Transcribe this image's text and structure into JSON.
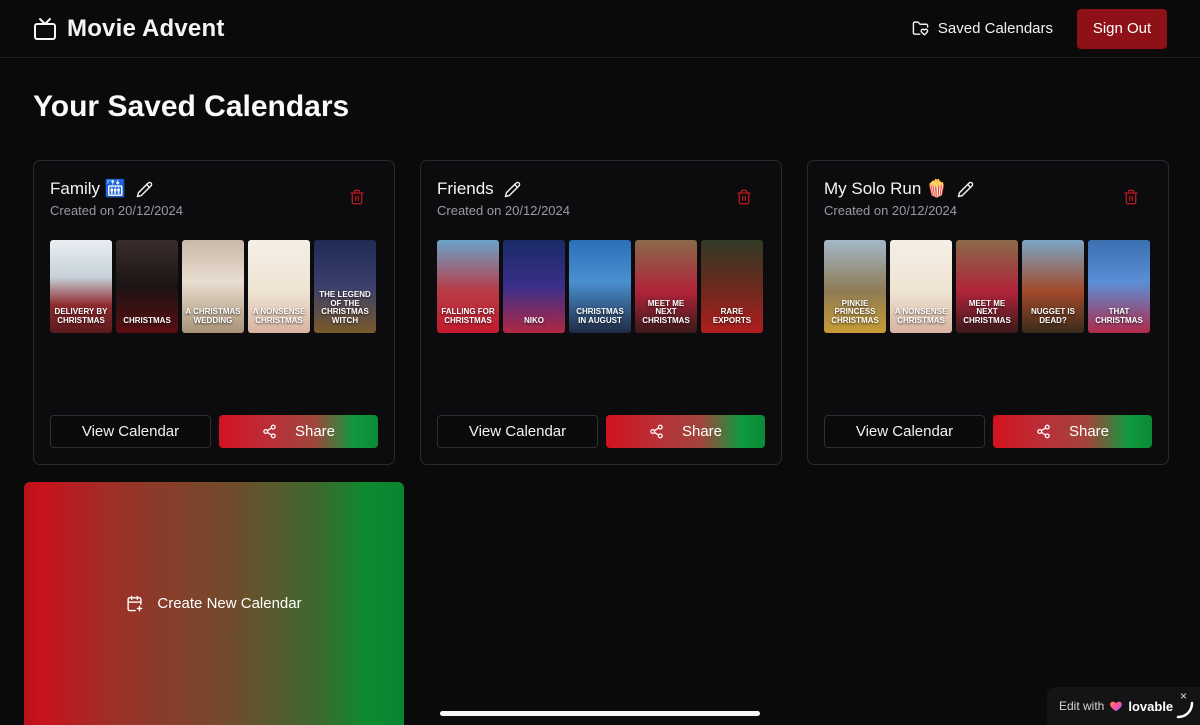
{
  "header": {
    "brand": "Movie Advent",
    "saved_calendars_label": "Saved Calendars",
    "signout_label": "Sign Out"
  },
  "page_title": "Your Saved Calendars",
  "colors": {
    "signout_bg": "#8e1118",
    "trash": "#b3191f",
    "share_red": "#d3121f",
    "share_green": "#0b8a36"
  },
  "calendars": [
    {
      "name": "Family 🛗",
      "created": "Created on 20/12/2024",
      "posters": [
        {
          "label": "Delivery by Christmas",
          "bg": "linear-gradient(180deg,#e9eef2 0%,#c7d2da 40%,#8e2a2e 70%,#5a1a1d 100%)"
        },
        {
          "label": "Christmas",
          "bg": "linear-gradient(180deg,#3a2d2d 0%,#1c1414 50%,#5b0d12 100%)"
        },
        {
          "label": "A Christmas Wedding",
          "bg": "linear-gradient(180deg,#c9b9a8 0%,#e8ddd0 45%,#a89276 100%)"
        },
        {
          "label": "A Nonsense Christmas",
          "bg": "linear-gradient(180deg,#f4efe6 0%,#efe4d3 55%,#d8b3a0 100%)"
        },
        {
          "label": "The Legend of the Christmas Witch",
          "bg": "linear-gradient(180deg,#1f2c55 0%,#3b3f6b 50%,#7a5a2a 100%)"
        }
      ],
      "view_label": "View Calendar",
      "share_label": "Share"
    },
    {
      "name": "Friends",
      "created": "Created on 20/12/2024",
      "posters": [
        {
          "label": "Falling for Christmas",
          "bg": "linear-gradient(180deg,#6aa3c9 0%,#b73b46 55%,#c11a2c 100%)"
        },
        {
          "label": "Niko",
          "bg": "linear-gradient(180deg,#1a2b66 0%,#3a2f8a 50%,#b12743 100%)"
        },
        {
          "label": "Christmas in August",
          "bg": "linear-gradient(180deg,#2b6fb7 0%,#4a90d0 45%,#1f2a44 100%)"
        },
        {
          "label": "Meet Me Next Christmas",
          "bg": "linear-gradient(180deg,#8a6a4a 0%,#b0243a 55%,#3a1a1a 100%)"
        },
        {
          "label": "Rare Exports",
          "bg": "linear-gradient(180deg,#2f3a26 0%,#6a2a1e 50%,#b01e1e 100%)"
        }
      ],
      "view_label": "View Calendar",
      "share_label": "Share"
    },
    {
      "name": "My Solo Run 🍿",
      "created": "Created on 20/12/2024",
      "posters": [
        {
          "label": "Pinkie Princess Christmas",
          "bg": "linear-gradient(180deg,#a3b8c9 0%,#8e7b54 55%,#c89c36 100%)"
        },
        {
          "label": "A Nonsense Christmas",
          "bg": "linear-gradient(180deg,#f4efe6 0%,#efe4d3 55%,#d8b3a0 100%)"
        },
        {
          "label": "Meet Me Next Christmas",
          "bg": "linear-gradient(180deg,#8a6a4a 0%,#b0243a 55%,#3a1a1a 100%)"
        },
        {
          "label": "Nugget is Dead?",
          "bg": "linear-gradient(180deg,#7aa6c5 0%,#a24a2a 55%,#3a2a1a 100%)"
        },
        {
          "label": "That Christmas",
          "bg": "linear-gradient(180deg,#3b6fb0 0%,#5a8fd6 45%,#b02a4a 100%)"
        }
      ],
      "view_label": "View Calendar",
      "share_label": "Share"
    }
  ],
  "create_label": "Create New Calendar",
  "badge": {
    "edit_with": "Edit with",
    "brand": "lovable",
    "close": "×"
  }
}
